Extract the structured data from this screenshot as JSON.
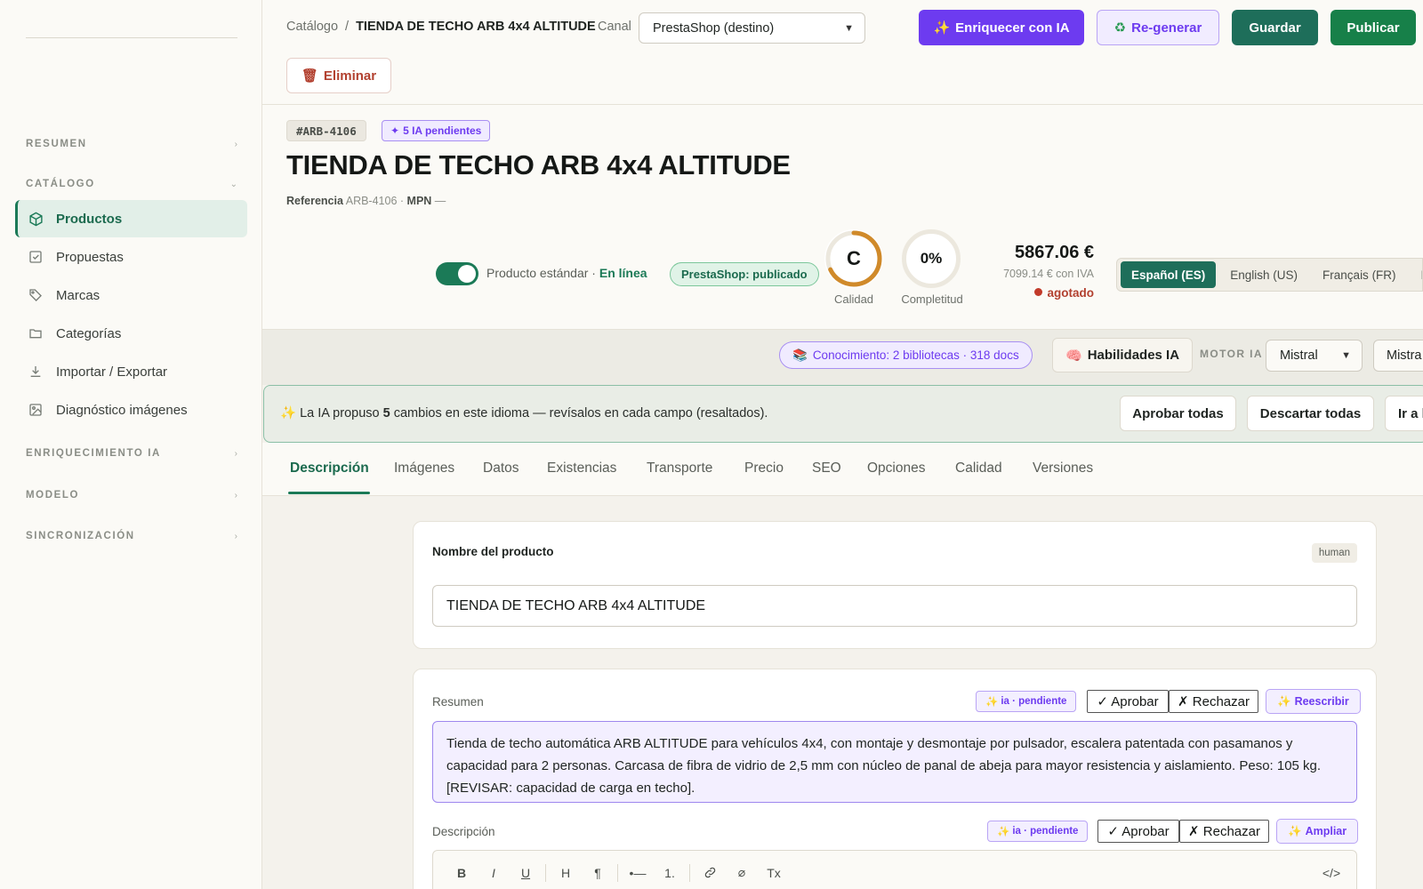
{
  "sidebar": {
    "sections": {
      "resumen": "RESUMEN",
      "catalogo": "CATÁLOGO",
      "enriquecimiento": "ENRIQUECIMIENTO IA",
      "modelo": "MODELO",
      "sincronizacion": "SINCRONIZACIÓN"
    },
    "items": [
      {
        "label": "Productos",
        "icon": "box-icon",
        "active": true
      },
      {
        "label": "Propuestas",
        "icon": "check-square-icon"
      },
      {
        "label": "Marcas",
        "icon": "tag-icon"
      },
      {
        "label": "Categorías",
        "icon": "folder-icon"
      },
      {
        "label": "Importar / Exportar",
        "icon": "download-icon"
      },
      {
        "label": "Diagnóstico imágenes",
        "icon": "image-icon"
      }
    ]
  },
  "header": {
    "breadcrumb_root": "Catálogo",
    "breadcrumb_sep": "/",
    "breadcrumb_current": "TIENDA DE TECHO ARB 4x4 ALTITUDE",
    "canal_label": "Canal",
    "canal_value": "PrestaShop (destino)",
    "enrich_button": "Enriquecer con IA",
    "regen_button": "Re-generar",
    "save_button": "Guardar",
    "publish_button": "Publicar",
    "delete_button": "Eliminar"
  },
  "product": {
    "sku": "#ARB-4106",
    "ai_pending": "5 IA pendientes",
    "title": "TIENDA DE TECHO ARB 4x4 ALTITUDE",
    "ref_label": "Referencia",
    "ref_value": "ARB-4106",
    "mpn_label": "MPN",
    "mpn_value": "—",
    "type_text": "Producto estándar ·",
    "online_text": "En línea",
    "channel_status": "PrestaShop: publicado",
    "quality_grade": "C",
    "quality_label": "Calidad",
    "quality_fraction": 0.68,
    "completeness_value": "0%",
    "completeness_label": "Completitud",
    "price": "5867.06 €",
    "price_iva": "7099.14 € con IVA",
    "stock_status": "agotado",
    "languages": [
      "Español (ES)",
      "English (US)",
      "Français (FR)",
      "Por"
    ]
  },
  "knowledge": {
    "badge": "Conocimiento: 2 bibliotecas · 318 docs",
    "skills_button": "Habilidades IA",
    "motor_label": "MOTOR IA",
    "motor_value": "Mistral",
    "motor_value2": "Mistra"
  },
  "notice": {
    "prefix": "La IA propuso",
    "count": "5",
    "suffix": "cambios en este idioma — revísalos en cada campo (resaltados).",
    "approve_all": "Aprobar todas",
    "discard_all": "Descartar todas",
    "goto": "Ir a l"
  },
  "tabs": [
    "Descripción",
    "Imágenes",
    "Datos",
    "Existencias",
    "Transporte",
    "Precio",
    "SEO",
    "Opciones",
    "Calidad",
    "Versiones"
  ],
  "fields": {
    "name_label": "Nombre del producto",
    "name_source": "human",
    "name_value": "TIENDA DE TECHO ARB 4x4 ALTITUDE",
    "summary_label": "Resumen",
    "summary_status": "ia · pendiente",
    "approve": "✓ Aprobar",
    "reject": "✗ Rechazar",
    "rewrite": "Reescribir",
    "summary_value": "Tienda de techo automática ARB ALTITUDE para vehículos 4x4, con montaje y desmontaje por pulsador, escalera patentada con pasamanos y capacidad para 2 personas. Carcasa de fibra de vidrio de 2,5 mm con núcleo de panal de abeja para mayor resistencia y aislamiento. Peso: 105 kg. [REVISAR: capacidad de carga en techo].",
    "desc_label": "Descripción",
    "desc_status": "ia · pendiente",
    "expand": "Ampliar",
    "toolbar": [
      "B",
      "I",
      "U",
      "H",
      "¶",
      "•—",
      "1.",
      "link",
      "unlink",
      "Tx",
      "</>"
    ]
  },
  "colors": {
    "accent_green": "#1b7a57",
    "ai_purple": "#6d3bf0",
    "danger": "#b2402f",
    "quality_ring": "#d08a2a"
  }
}
